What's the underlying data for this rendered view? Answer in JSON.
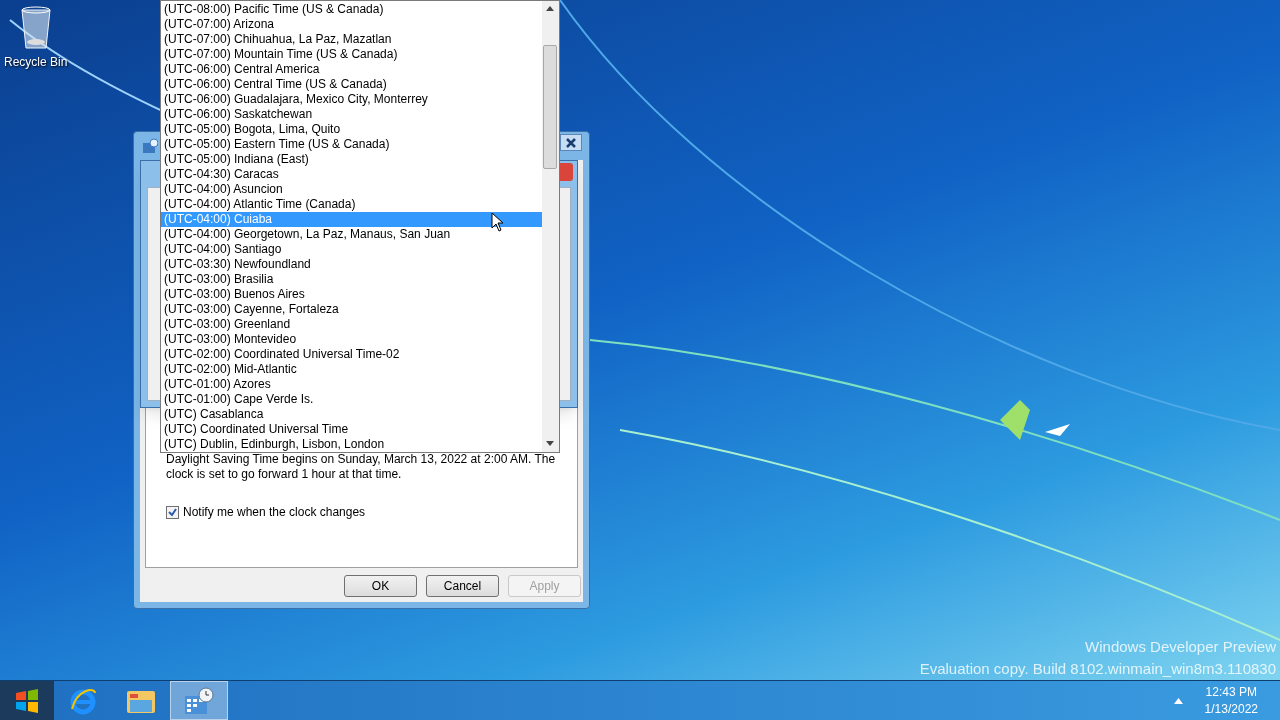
{
  "desktop": {
    "icons": [
      {
        "kind": "recycle-bin",
        "label": "Recycle Bin"
      }
    ],
    "watermark": [
      "Windows Developer Preview",
      "Evaluation copy. Build 8102.winmain_win8m3.110830"
    ]
  },
  "dialog": {
    "info_text": "Daylight Saving Time begins on Sunday, March 13, 2022 at 2:00 AM. The clock is set to go forward 1 hour at that time.",
    "notify_checkbox": {
      "label": "Notify me when the clock changes",
      "checked": true
    },
    "buttons": [
      {
        "label": "OK",
        "disabled": false
      },
      {
        "label": "Cancel",
        "disabled": false
      },
      {
        "label": "Apply",
        "disabled": true
      }
    ]
  },
  "timezone_list": {
    "items": [
      {
        "label": "(UTC-08:00) Pacific Time (US & Canada)",
        "selected": false
      },
      {
        "label": "(UTC-07:00) Arizona",
        "selected": false
      },
      {
        "label": "(UTC-07:00) Chihuahua, La Paz, Mazatlan",
        "selected": false
      },
      {
        "label": "(UTC-07:00) Mountain Time (US & Canada)",
        "selected": false
      },
      {
        "label": "(UTC-06:00) Central America",
        "selected": false
      },
      {
        "label": "(UTC-06:00) Central Time (US & Canada)",
        "selected": false
      },
      {
        "label": "(UTC-06:00) Guadalajara, Mexico City, Monterrey",
        "selected": false
      },
      {
        "label": "(UTC-06:00) Saskatchewan",
        "selected": false
      },
      {
        "label": "(UTC-05:00) Bogota, Lima, Quito",
        "selected": false
      },
      {
        "label": "(UTC-05:00) Eastern Time (US & Canada)",
        "selected": false
      },
      {
        "label": "(UTC-05:00) Indiana (East)",
        "selected": false
      },
      {
        "label": "(UTC-04:30) Caracas",
        "selected": false
      },
      {
        "label": "(UTC-04:00) Asuncion",
        "selected": false
      },
      {
        "label": "(UTC-04:00) Atlantic Time (Canada)",
        "selected": false
      },
      {
        "label": "(UTC-04:00) Cuiaba",
        "selected": true
      },
      {
        "label": "(UTC-04:00) Georgetown, La Paz, Manaus, San Juan",
        "selected": false
      },
      {
        "label": "(UTC-04:00) Santiago",
        "selected": false
      },
      {
        "label": "(UTC-03:30) Newfoundland",
        "selected": false
      },
      {
        "label": "(UTC-03:00) Brasilia",
        "selected": false
      },
      {
        "label": "(UTC-03:00) Buenos Aires",
        "selected": false
      },
      {
        "label": "(UTC-03:00) Cayenne, Fortaleza",
        "selected": false
      },
      {
        "label": "(UTC-03:00) Greenland",
        "selected": false
      },
      {
        "label": "(UTC-03:00) Montevideo",
        "selected": false
      },
      {
        "label": "(UTC-02:00) Coordinated Universal Time-02",
        "selected": false
      },
      {
        "label": "(UTC-02:00) Mid-Atlantic",
        "selected": false
      },
      {
        "label": "(UTC-01:00) Azores",
        "selected": false
      },
      {
        "label": "(UTC-01:00) Cape Verde Is.",
        "selected": false
      },
      {
        "label": "(UTC) Casablanca",
        "selected": false
      },
      {
        "label": "(UTC) Coordinated Universal Time",
        "selected": false
      },
      {
        "label": "(UTC) Dublin, Edinburgh, Lisbon, London",
        "selected": false
      }
    ]
  },
  "taskbar": {
    "items": [
      {
        "kind": "start",
        "selected": false
      },
      {
        "kind": "browser",
        "selected": false
      },
      {
        "kind": "folder",
        "selected": false
      },
      {
        "kind": "calendar",
        "selected": true
      }
    ],
    "clock": {
      "time": "12:43 PM",
      "date": "1/13/2022"
    }
  }
}
